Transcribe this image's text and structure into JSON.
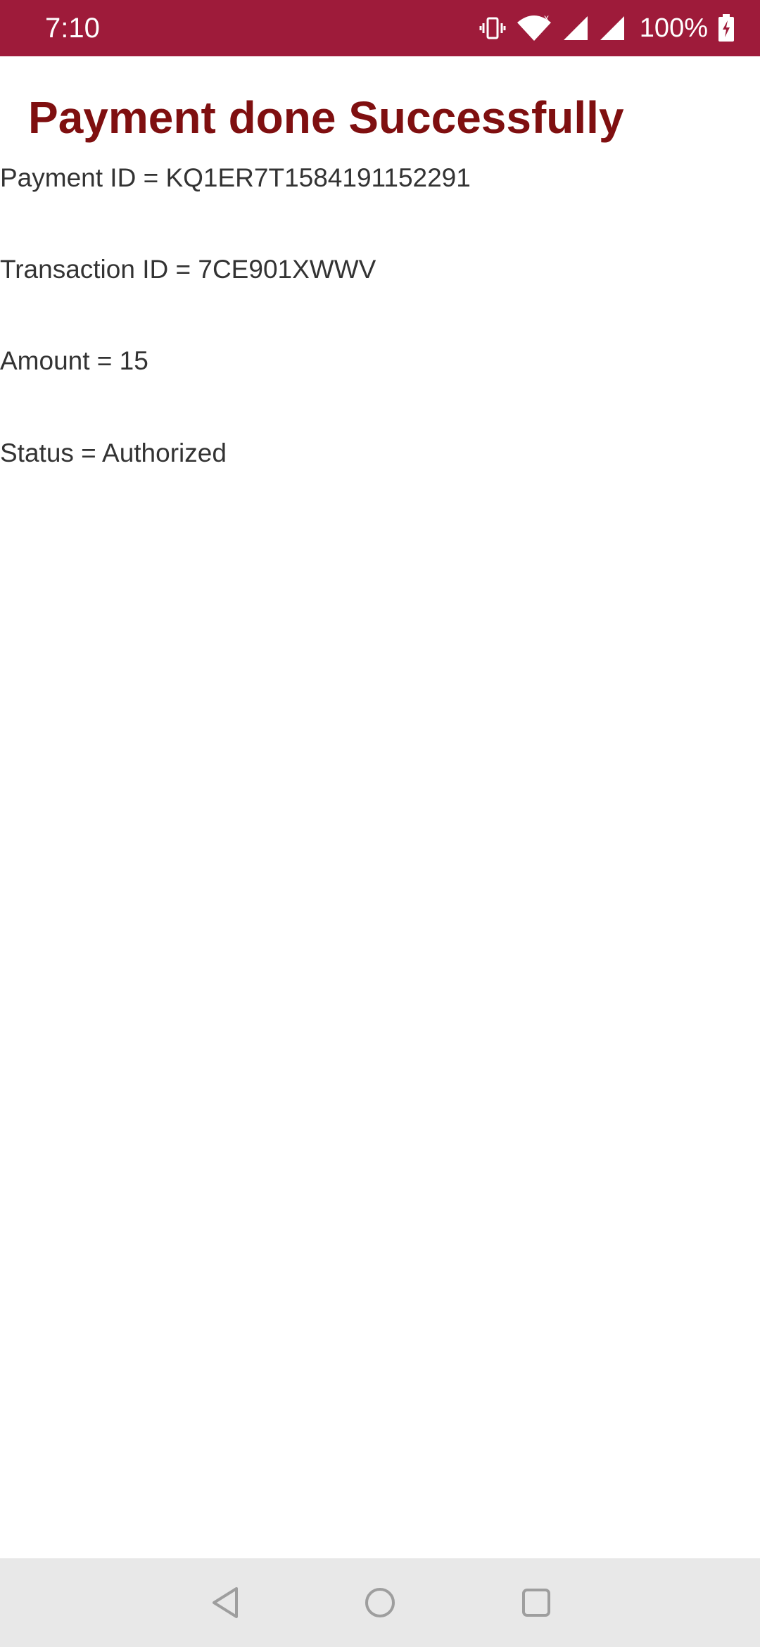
{
  "status_bar": {
    "time": "7:10",
    "battery": "100%",
    "icons": [
      "vibrate-icon",
      "wifi-icon",
      "signal-icon",
      "signal-icon",
      "battery-charging-icon"
    ],
    "background_color": "#9e1b3a"
  },
  "page": {
    "title": "Payment done Successfully",
    "title_color": "#7f0f10",
    "details": {
      "payment_id": "Payment ID = KQ1ER7T1584191152291",
      "transaction_id": "Transaction ID = 7CE901XWWV",
      "amount": "Amount = 15",
      "status": "Status = Authorized"
    }
  },
  "nav_bar": {
    "buttons": [
      "back-icon",
      "home-icon",
      "recents-icon"
    ]
  }
}
